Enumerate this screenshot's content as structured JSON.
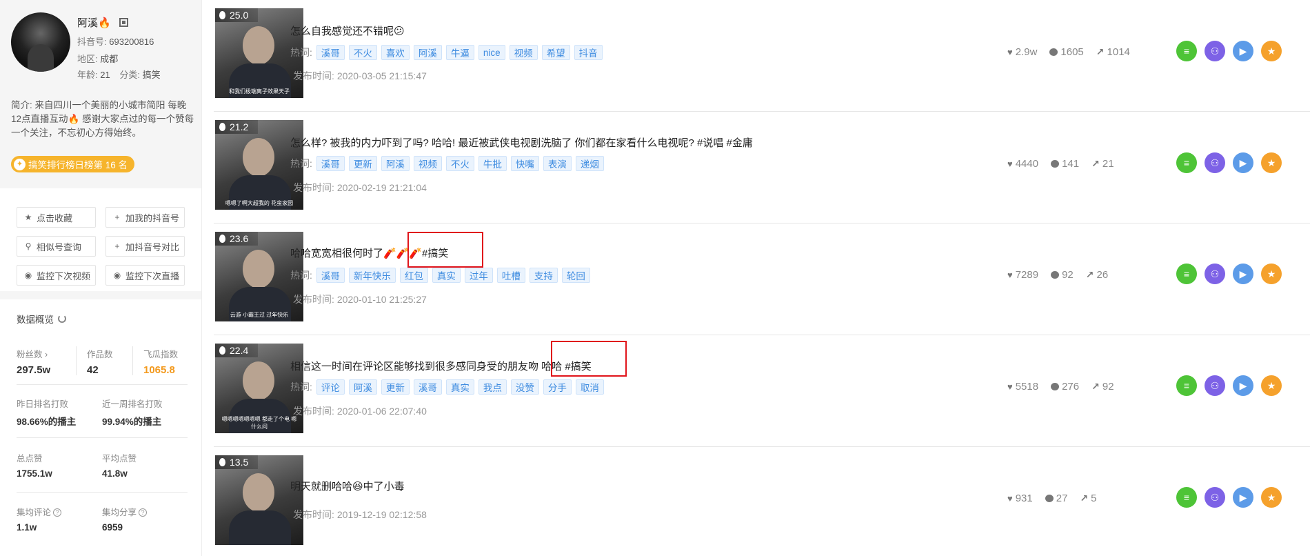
{
  "profile": {
    "name": "阿溪🔥",
    "douyin_id_label": "抖音号:",
    "douyin_id": "693200816",
    "region_label": "地区:",
    "region": "成都",
    "age_label": "年龄:",
    "age": "21",
    "category_label": "分类:",
    "category": "搞笑",
    "bio": "简介: 来自四川一个美丽的小城市简阳 每晚12点直播互动🔥 感谢大家点过的每一个赞每一个关注，不忘初心方得始终。",
    "rank_badge": "搞笑排行榜日榜第 16 名"
  },
  "actions": [
    {
      "icon": "★",
      "label": "点击收藏"
    },
    {
      "icon": "+",
      "label": "加我的抖音号"
    },
    {
      "icon": "⚲",
      "label": "相似号查询"
    },
    {
      "icon": "+",
      "label": "加抖音号对比"
    },
    {
      "icon": "◉",
      "label": "监控下次视频"
    },
    {
      "icon": "◉",
      "label": "监控下次直播"
    }
  ],
  "overview": {
    "title": "数据概览",
    "fans_label": "粉丝数 ›",
    "fans": "297.5w",
    "works_label": "作品数",
    "works": "42",
    "feigua_label": "飞瓜指数",
    "feigua": "1065.8",
    "yesterday_rank_label": "昨日排名打败",
    "yesterday_rank": "98.66%的播主",
    "week_rank_label": "近一周排名打败",
    "week_rank": "99.94%的播主",
    "total_likes_label": "总点赞",
    "total_likes": "1755.1w",
    "avg_likes_label": "平均点赞",
    "avg_likes": "41.8w",
    "avg_comments_label": "集均评论",
    "avg_comments": "1.1w",
    "avg_shares_label": "集均分享",
    "avg_shares": "6959"
  },
  "labels": {
    "hot_words": "热词:",
    "publish_time": "发布时间:"
  },
  "videos": [
    {
      "score": "25.0",
      "title": "怎么自我感觉还不错呢😕",
      "thumb_caption": "和我们极端离子效果天子",
      "tags": [
        "溪哥",
        "不火",
        "喜欢",
        "阿溪",
        "牛逼",
        "nice",
        "视频",
        "希望",
        "抖音"
      ],
      "publish_time": "2020-03-05 21:15:47",
      "likes": "2.9w",
      "comments": "1605",
      "shares": "1014"
    },
    {
      "score": "21.2",
      "title": "怎么样? 被我的内力吓到了吗? 哈哈! 最近被武侠电视剧洗脑了 你们都在家看什么电视呢? #说唱 #金庸",
      "thumb_caption": "嗯嗯了啊大超我的 花蛮家园",
      "tags": [
        "溪哥",
        "更新",
        "阿溪",
        "视频",
        "不火",
        "牛批",
        "快嘴",
        "表演",
        "递烟"
      ],
      "publish_time": "2020-02-19 21:21:04",
      "likes": "4440",
      "comments": "141",
      "shares": "21"
    },
    {
      "score": "23.6",
      "title": "哈哈宽宽相很何时了🧨🧨🧨#搞笑",
      "thumb_caption": "云游 小霸王过 过年快乐",
      "tags": [
        "溪哥",
        "新年快乐",
        "红包",
        "真实",
        "过年",
        "吐槽",
        "支持",
        "轮回"
      ],
      "publish_time": "2020-01-10 21:25:27",
      "likes": "7289",
      "comments": "92",
      "shares": "26"
    },
    {
      "score": "22.4",
      "title": "相信这一时间在评论区能够找到很多感同身受的朋友吻 哈哈 #搞笑",
      "thumb_caption": "嗯嗯嗯嗯嗯嗯嗯 都走了个电 嗯什么问",
      "tags": [
        "评论",
        "阿溪",
        "更新",
        "溪哥",
        "真实",
        "我点",
        "没赞",
        "分手",
        "取消"
      ],
      "publish_time": "2020-01-06 22:07:40",
      "likes": "5518",
      "comments": "276",
      "shares": "92"
    },
    {
      "score": "13.5",
      "title": "明天就删哈哈😆中了小毒",
      "thumb_caption": "",
      "tags": [],
      "publish_time": "2019-12-19 02:12:58",
      "likes": "931",
      "comments": "27",
      "shares": "5"
    }
  ],
  "op_buttons": [
    {
      "icon": "list-icon",
      "glyph": "≡",
      "color": "#4ec437"
    },
    {
      "icon": "users-icon",
      "glyph": "⚇",
      "color": "#7d62e6"
    },
    {
      "icon": "play-icon",
      "glyph": "▶",
      "color": "#5c9be8"
    },
    {
      "icon": "star-icon",
      "glyph": "★",
      "color": "#f5a12c"
    }
  ],
  "colors": {
    "tag_text": "#3d8be0",
    "tag_bg": "#eaf3fd",
    "highlight_box": "#e0141b",
    "rank_badge": "#f6b42c",
    "feigua": "#f39a1e"
  }
}
